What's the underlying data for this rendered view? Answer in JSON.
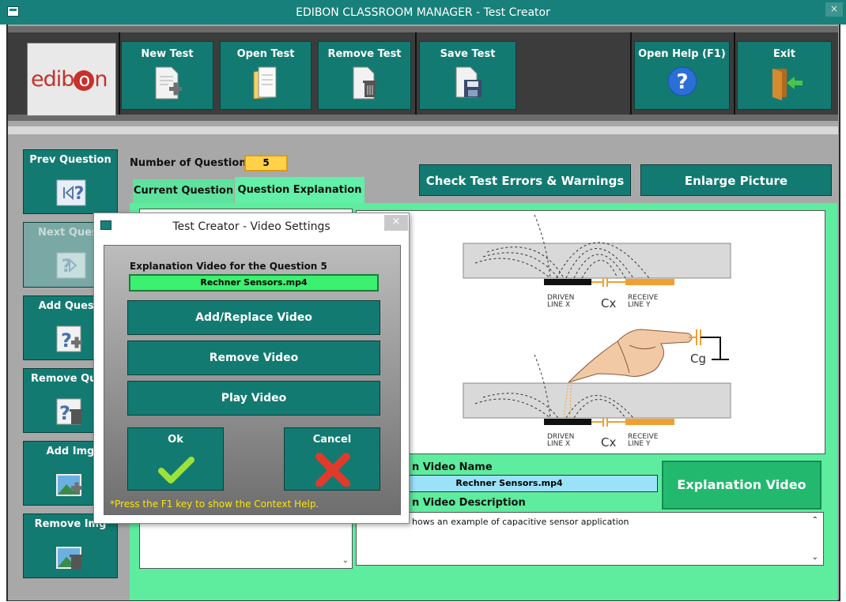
{
  "window": {
    "title": "EDIBON CLASSROOM MANAGER - Test Creator",
    "close_glyph": "×"
  },
  "logo": {
    "text_before": "edib",
    "text_o": "o",
    "text_after": "n"
  },
  "toolbar": {
    "new_test": "New Test",
    "open_test": "Open Test",
    "remove_test": "Remove Test",
    "save_test": "Save Test",
    "open_help": "Open Help (F1)",
    "exit": "Exit"
  },
  "sidebar": {
    "prev_question": "Prev Question",
    "next_question": "Next Quest",
    "add_question": "Add Questi",
    "remove_question": "Remove Ques",
    "add_image": "Add Img",
    "remove_image": "Remove Img"
  },
  "questions": {
    "label": "Number of Questions",
    "count": "5"
  },
  "tabs": {
    "current": "Current Question",
    "explanation": "Question Explanation"
  },
  "actions": {
    "check_errors": "Check Test Errors & Warnings",
    "enlarge_picture": "Enlarge Picture"
  },
  "diagram": {
    "driven": "DRIVEN",
    "line_x": "LINE X",
    "cx": "Cx",
    "receive": "RECEIVE",
    "line_y": "LINE Y",
    "cg": "Cg"
  },
  "explanation": {
    "name_label": "n Video Name",
    "name_value": "Rechner Sensors.mp4",
    "button": "Explanation Video",
    "desc_label": "n Video Description",
    "desc_value": "hows an example of capacitive sensor application"
  },
  "dialog": {
    "title": "Test Creator - Video Settings",
    "close_glyph": "×",
    "video_label": "Explanation Video for the Question 5",
    "video_file": "Rechner Sensors.mp4",
    "add_replace": "Add/Replace Video",
    "remove": "Remove Video",
    "play": "Play Video",
    "ok": "Ok",
    "cancel": "Cancel",
    "hint": "*Press the F1 key to show the Context Help."
  },
  "colors": {
    "teal": "#137a72",
    "green_panel": "#5eec9f",
    "title_bar": "#18807a",
    "accent_yellow": "#ffd24a"
  }
}
